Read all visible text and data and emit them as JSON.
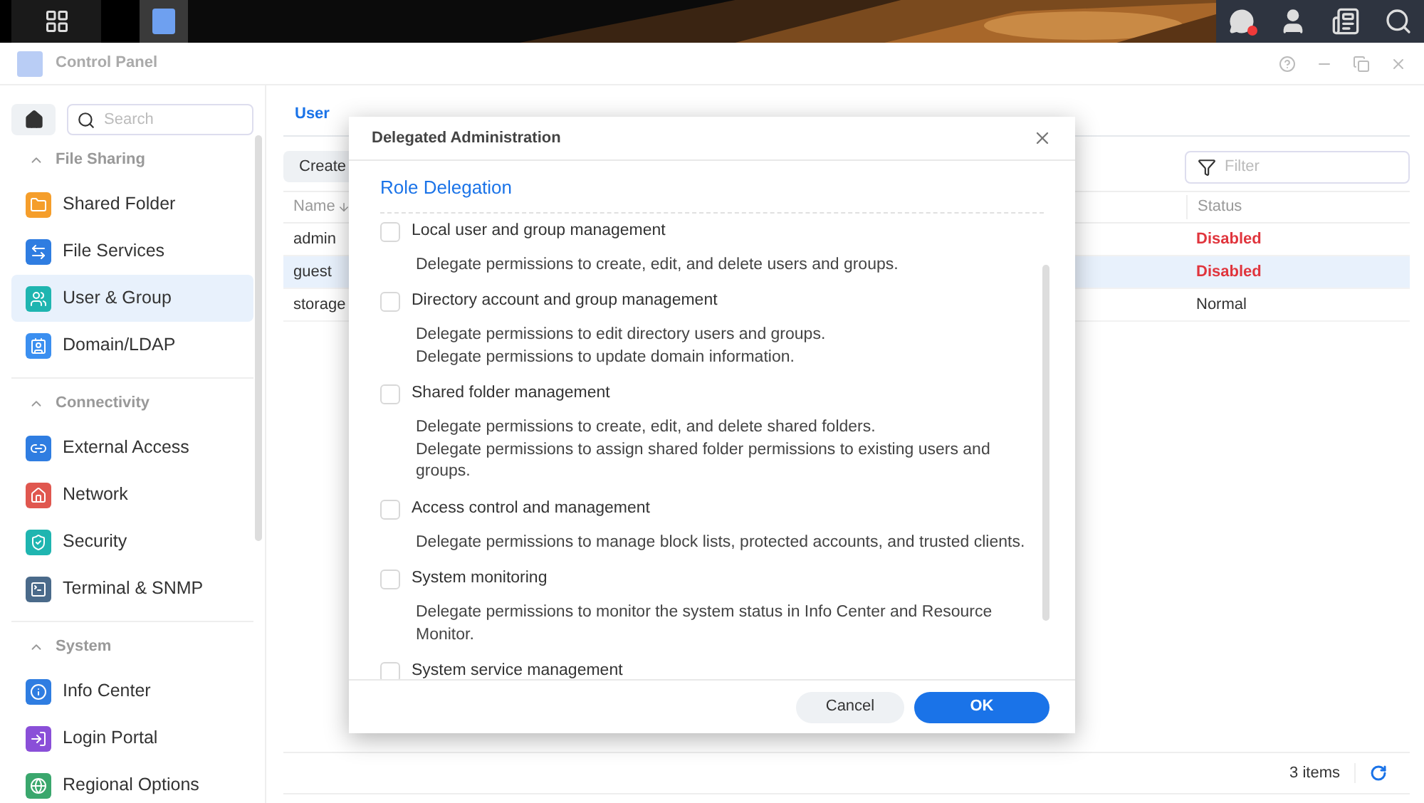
{
  "window": {
    "title": "Control Panel"
  },
  "sidebar": {
    "search_placeholder": "Search",
    "sections": [
      {
        "title": "File Sharing",
        "expanded": true,
        "items": [
          {
            "label": "Shared Folder",
            "kind": "folder",
            "selected": false
          },
          {
            "label": "File Services",
            "kind": "services",
            "selected": false
          },
          {
            "label": "User & Group",
            "kind": "users",
            "selected": true
          },
          {
            "label": "Domain/LDAP",
            "kind": "domain",
            "selected": false
          }
        ]
      },
      {
        "title": "Connectivity",
        "expanded": true,
        "items": [
          {
            "label": "External Access",
            "kind": "link",
            "selected": false
          },
          {
            "label": "Network",
            "kind": "network",
            "selected": false
          },
          {
            "label": "Security",
            "kind": "shield",
            "selected": false
          },
          {
            "label": "Terminal & SNMP",
            "kind": "terminal",
            "selected": false
          }
        ]
      },
      {
        "title": "System",
        "expanded": true,
        "items": [
          {
            "label": "Info Center",
            "kind": "info",
            "selected": false
          },
          {
            "label": "Login Portal",
            "kind": "portal",
            "selected": false
          },
          {
            "label": "Regional Options",
            "kind": "regional",
            "selected": false
          }
        ]
      }
    ]
  },
  "tabs": [
    {
      "label": "User",
      "selected": true
    }
  ],
  "toolbar": {
    "create_button": "Create",
    "filter_placeholder": "Filter"
  },
  "table": {
    "columns": [
      "Name",
      "Status"
    ],
    "rows": [
      {
        "name": "admin",
        "status": "Disabled",
        "disabled": true,
        "selected": false
      },
      {
        "name": "guest",
        "status": "Disabled",
        "disabled": true,
        "selected": true
      },
      {
        "name": "storage",
        "status": "Normal",
        "disabled": false,
        "selected": false
      }
    ]
  },
  "status_bar": {
    "count": "3 items"
  },
  "dialog": {
    "title": "Delegated Administration",
    "section": "Role Delegation",
    "roles": [
      {
        "label": "Local user and group management",
        "checked": false,
        "description": [
          "Delegate permissions to create, edit, and delete users and groups."
        ]
      },
      {
        "label": "Directory account and group management",
        "checked": false,
        "description": [
          "Delegate permissions to edit directory users and groups.",
          "Delegate permissions to update domain information."
        ]
      },
      {
        "label": "Shared folder management",
        "checked": false,
        "description": [
          "Delegate permissions to create, edit, and delete shared folders.",
          "Delegate permissions to assign shared folder permissions to existing users and groups."
        ]
      },
      {
        "label": "Access control and management",
        "checked": false,
        "description": [
          "Delegate permissions to manage block lists, protected accounts, and trusted clients."
        ]
      },
      {
        "label": "System monitoring",
        "checked": false,
        "description": [
          "Delegate permissions to monitor the system status in Info Center and Resource Monitor."
        ]
      },
      {
        "label": "System service management",
        "checked": false
      }
    ],
    "buttons": {
      "cancel": "Cancel",
      "ok": "OK"
    }
  }
}
